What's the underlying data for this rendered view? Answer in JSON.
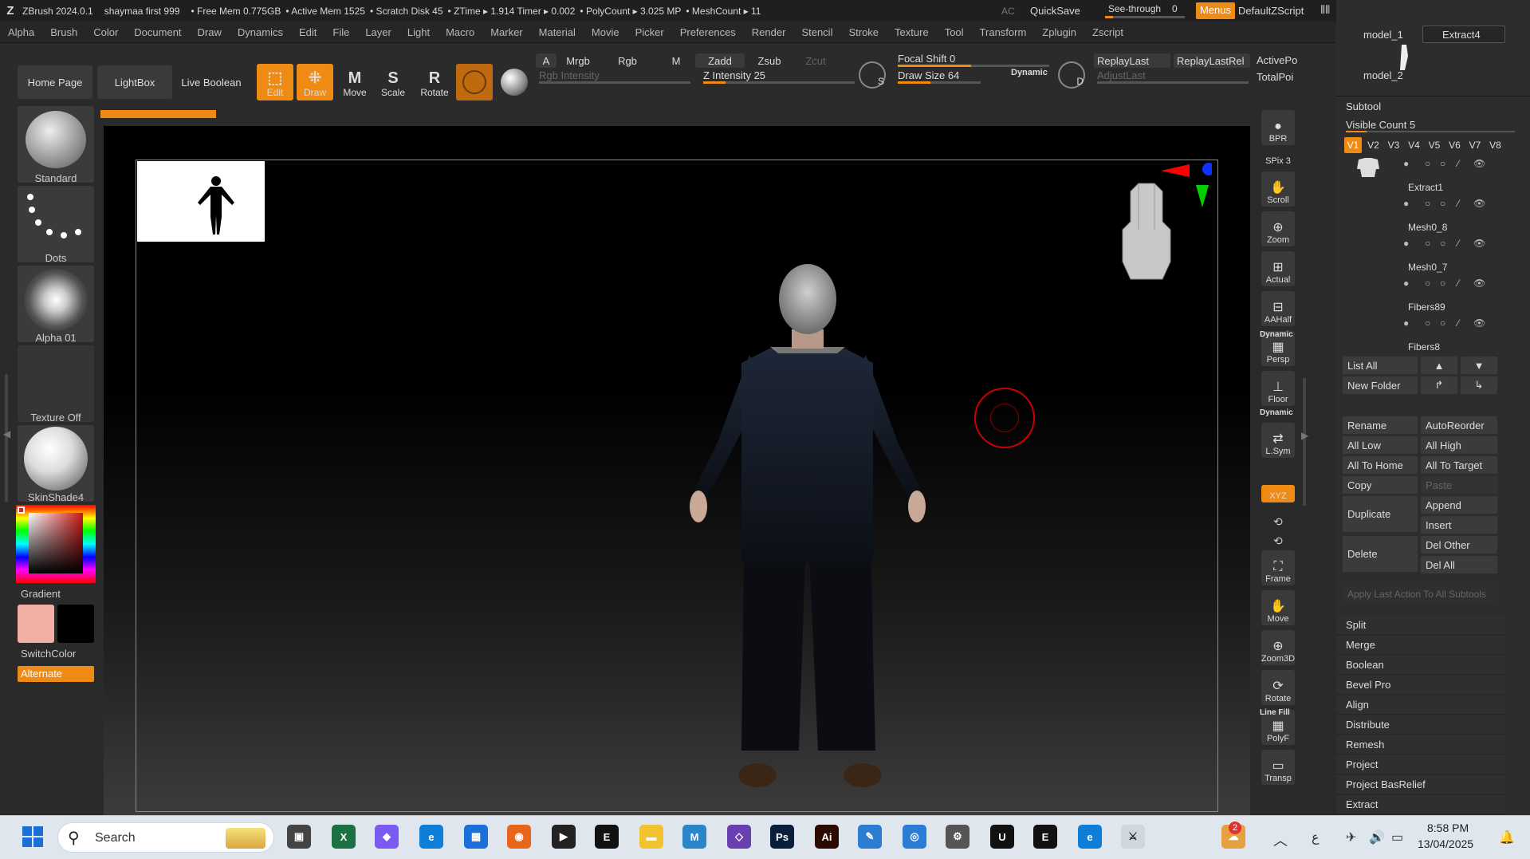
{
  "titlebar": {
    "app": "ZBrush 2024.0.1",
    "user": "shaymaa first 999",
    "free_mem": "• Free Mem 0.775GB",
    "active_mem": "• Active Mem 1525",
    "scratch": "• Scratch Disk 45",
    "ztime": "• ZTime ▸ 1.914 Timer ▸ 0.002",
    "polycount": "• PolyCount ▸ 3.025 MP",
    "meshcount": "• MeshCount ▸ 11",
    "ac": "AC",
    "quicksave": "QuickSave",
    "see_through": "See-through",
    "see_through_value": "0",
    "menus": "Menus",
    "default_script": "DefaultZScript"
  },
  "menubar": [
    "Alpha",
    "Brush",
    "Color",
    "Document",
    "Draw",
    "Dynamics",
    "Edit",
    "File",
    "Layer",
    "Light",
    "Macro",
    "Marker",
    "Material",
    "Movie",
    "Picker",
    "Preferences",
    "Render",
    "Stencil",
    "Stroke",
    "Texture",
    "Tool",
    "Transform",
    "Zplugin",
    "Zscript"
  ],
  "toolbar": {
    "home_page": "Home Page",
    "lightbox": "LightBox",
    "live_boolean": "Live Boolean",
    "edit": "Edit",
    "draw": "Draw",
    "move": "Move",
    "scale": "Scale",
    "rotate": "Rotate",
    "a": "A",
    "mrgb": "Mrgb",
    "rgb": "Rgb",
    "m": "M",
    "zadd": "Zadd",
    "zsub": "Zsub",
    "zcut": "Zcut",
    "rgb_intensity": "Rgb Intensity",
    "z_intensity": "Z Intensity 25",
    "z_intensity_value": 25,
    "focal_shift": "Focal Shift 0",
    "draw_size": "Draw Size 64",
    "draw_size_value": 64,
    "dynamic": "Dynamic",
    "replay_last": "ReplayLast",
    "replay_last_rel": "ReplayLastRel",
    "adjust_last": "AdjustLast",
    "active_po": "ActivePo",
    "total_poi": "TotalPoi",
    "s": "S",
    "d": "D"
  },
  "left_palette": {
    "brush": "Standard",
    "stroke": "Dots",
    "alpha": "Alpha 01",
    "texture": "Texture Off",
    "material": "SkinShade4",
    "gradient": "Gradient",
    "switch_color": "SwitchColor",
    "alternate": "Alternate",
    "main_color": "#f0b0a4",
    "secondary_color": "#000000"
  },
  "right_strip": [
    {
      "label": "BPR",
      "icon": "sphere-icon"
    },
    {
      "label": "SPix 3",
      "icon": ""
    },
    {
      "label": "Scroll",
      "icon": "hand-icon"
    },
    {
      "label": "Zoom",
      "icon": "zoom-icon"
    },
    {
      "label": "Actual",
      "icon": "actual-icon"
    },
    {
      "label": "AAHalf",
      "icon": "aahalf-icon"
    },
    {
      "label": "Persp",
      "icon": "persp-icon"
    },
    {
      "label": "Floor",
      "icon": "floor-icon"
    },
    {
      "label": "L.Sym",
      "icon": "lsym-icon"
    },
    {
      "label": "XYZ",
      "icon": "xyz-icon"
    },
    {
      "label": "Frame",
      "icon": "frame-icon"
    },
    {
      "label": "Move",
      "icon": "move-icon"
    },
    {
      "label": "Zoom3D",
      "icon": "zoom3d-icon"
    },
    {
      "label": "Rotate",
      "icon": "rotate-icon"
    },
    {
      "label": "PolyF",
      "icon": "polyf-icon"
    },
    {
      "label": "Transp",
      "icon": "transp-icon"
    }
  ],
  "right_strip_extra": {
    "dynamic1": "Dynamic",
    "dynamic2": "Dynamic",
    "line_fill": "Line Fill"
  },
  "subtool": {
    "top_items": [
      "model_1",
      "Extract4",
      "model_2"
    ],
    "title": "Subtool",
    "visible_count": "Visible Count 5",
    "versions": [
      "V1",
      "V2",
      "V3",
      "V4",
      "V5",
      "V6",
      "V7",
      "V8"
    ],
    "items": [
      "Extract1",
      "Mesh0_8",
      "Mesh0_7",
      "Fibers89",
      "Fibers8"
    ],
    "list_all": "List All",
    "new_folder": "New Folder",
    "rename": "Rename",
    "auto_reorder": "AutoReorder",
    "all_low": "All Low",
    "all_high": "All High",
    "all_to_home": "All To Home",
    "all_to_target": "All To Target",
    "copy": "Copy",
    "paste": "Paste",
    "duplicate": "Duplicate",
    "append": "Append",
    "insert": "Insert",
    "delete": "Delete",
    "del_other": "Del Other",
    "del_all": "Del All",
    "apply_last": "Apply Last Action To All Subtools",
    "sections": [
      "Split",
      "Merge",
      "Boolean",
      "Bevel Pro",
      "Align",
      "Distribute",
      "Remesh",
      "Project",
      "Project BasRelief",
      "Extract"
    ]
  },
  "taskbar": {
    "search": "Search",
    "time": "8:58 PM",
    "date": "13/04/2025",
    "badge": "2",
    "lang": "ع"
  }
}
